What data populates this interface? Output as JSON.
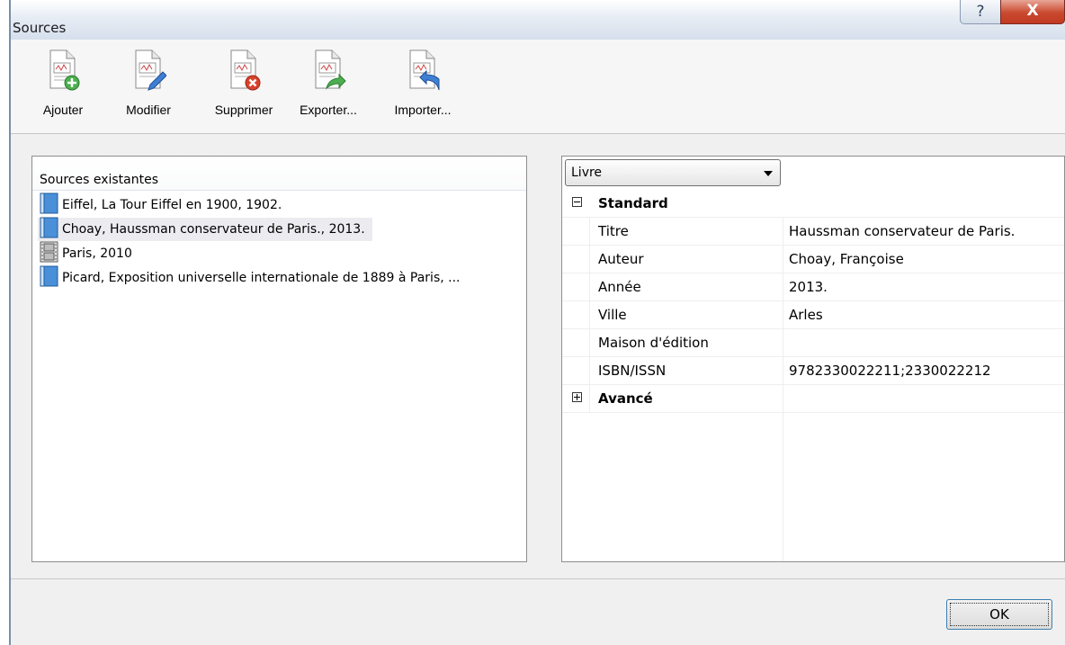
{
  "window": {
    "title": "Sources",
    "help_glyph": "?",
    "close_glyph": "X"
  },
  "toolbar": [
    {
      "label": "Ajouter",
      "icon": "document-add-icon"
    },
    {
      "label": "Modifier",
      "icon": "document-edit-icon"
    },
    {
      "label": "Supprimer",
      "icon": "document-delete-icon"
    },
    {
      "label": "Exporter...",
      "icon": "document-export-icon"
    },
    {
      "label": "Importer...",
      "icon": "document-import-icon"
    }
  ],
  "sources": {
    "header": "Sources existantes",
    "items": [
      {
        "label": "Eiffel, La Tour Eiffel en 1900, 1902.",
        "icon": "book-icon",
        "selected": false
      },
      {
        "label": "Choay, Haussman conservateur de Paris., 2013.",
        "icon": "book-icon",
        "selected": true
      },
      {
        "label": "Paris, 2010",
        "icon": "film-icon",
        "selected": false
      },
      {
        "label": "Picard, Exposition universelle internationale de 1889 à Paris, ...",
        "icon": "book-icon",
        "selected": false
      }
    ]
  },
  "details": {
    "type_value": "Livre",
    "standard_label": "Standard",
    "fields": [
      {
        "key": "Titre",
        "value": "Haussman conservateur de Paris."
      },
      {
        "key": "Auteur",
        "value": "Choay, Françoise"
      },
      {
        "key": "Année",
        "value": "2013."
      },
      {
        "key": "Ville",
        "value": "Arles"
      },
      {
        "key": "Maison d'édition",
        "value": ""
      },
      {
        "key": "ISBN/ISSN",
        "value": "9782330022211;2330022212"
      }
    ],
    "advanced_label": "Avancé"
  },
  "footer": {
    "ok_label": "OK"
  },
  "colors": {
    "book_blue": "#4a90d9",
    "close_red": "#c9492f",
    "titlebar_blue": "#d5dfec"
  }
}
